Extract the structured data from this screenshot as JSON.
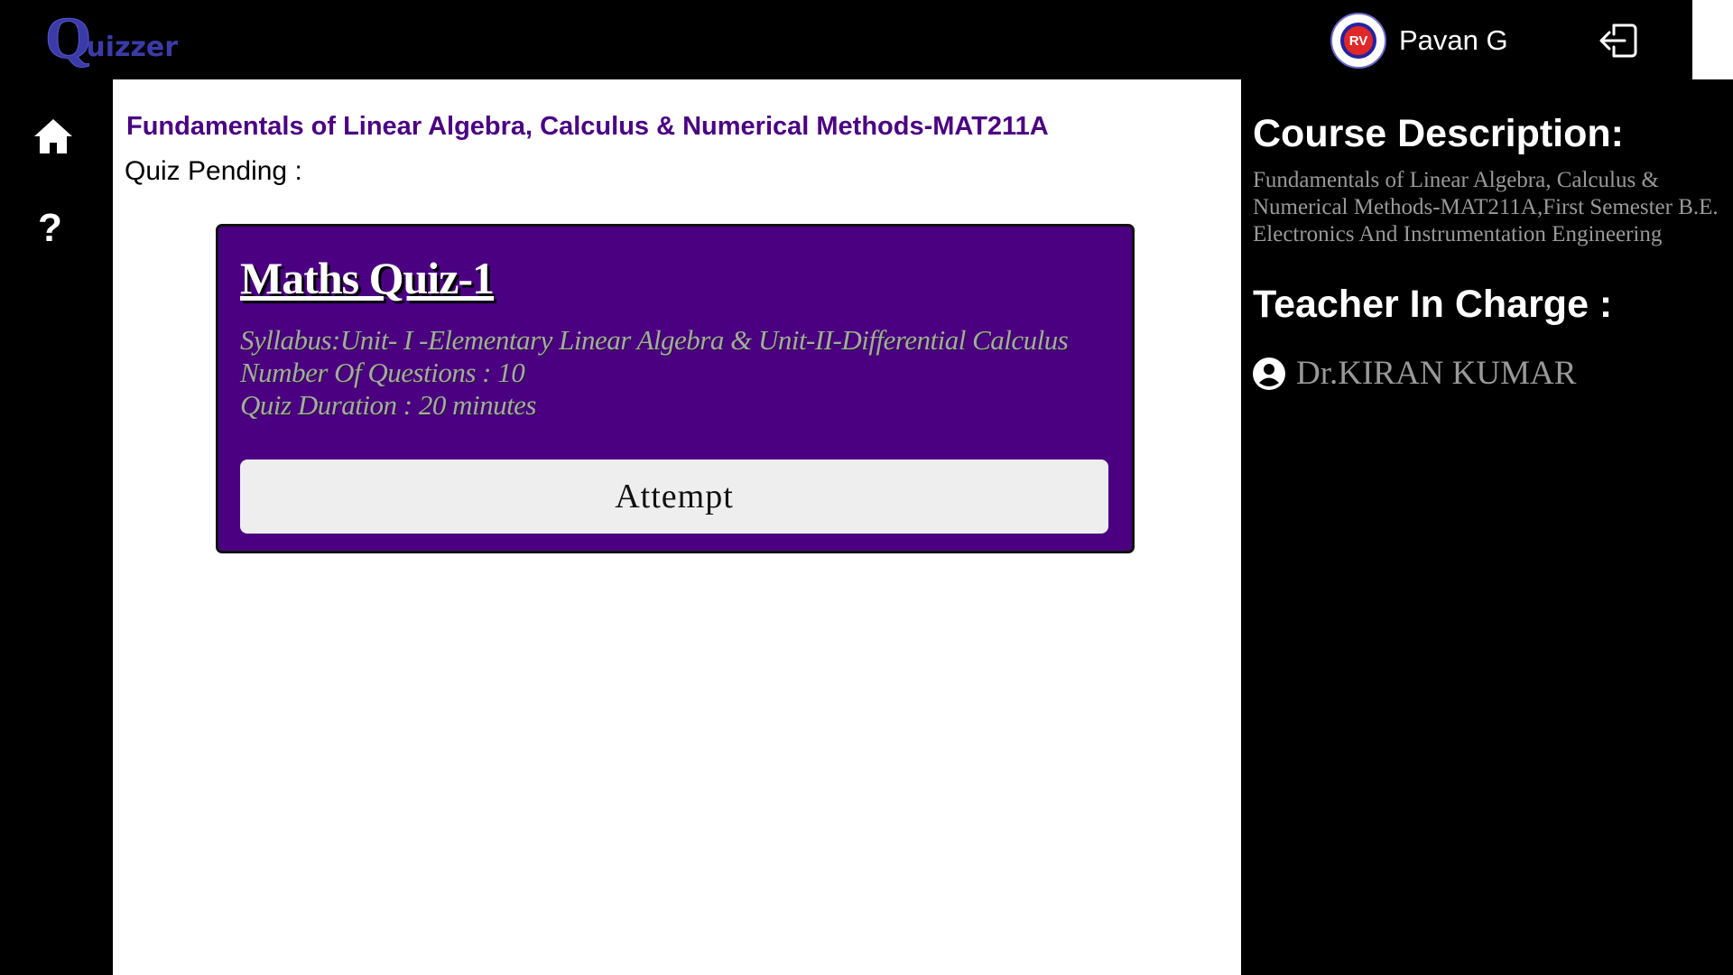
{
  "header": {
    "logo_text": "Quizzer",
    "logo_q": "Q",
    "logo_rest": "uizzer",
    "user_name": "Pavan G",
    "institution_badge": "RV",
    "logout_icon": "logout-icon"
  },
  "sidebar": {
    "home_icon": "home-icon",
    "help_label": "?"
  },
  "main": {
    "course_title": "Fundamentals of Linear Algebra, Calculus & Numerical Methods-MAT211A",
    "pending_label": "Quiz Pending :",
    "quiz": {
      "title": "Maths Quiz-1",
      "syllabus": "Syllabus:Unit- I -Elementary Linear Algebra & Unit-II-Differential Calculus",
      "questions": "Number Of Questions : 10",
      "duration": "Quiz Duration : 20 minutes",
      "attempt_label": "Attempt"
    }
  },
  "right": {
    "desc_heading": "Course Description:",
    "description": "Fundamentals of Linear Algebra, Calculus & Numerical Methods-MAT211A,First Semester B.E. Electronics And Instrumentation Engineering",
    "teacher_heading": "Teacher In Charge :",
    "teacher_name": "Dr.KIRAN KUMAR"
  },
  "colors": {
    "accent": "#4b0082",
    "logo": "#3b3ba8"
  }
}
